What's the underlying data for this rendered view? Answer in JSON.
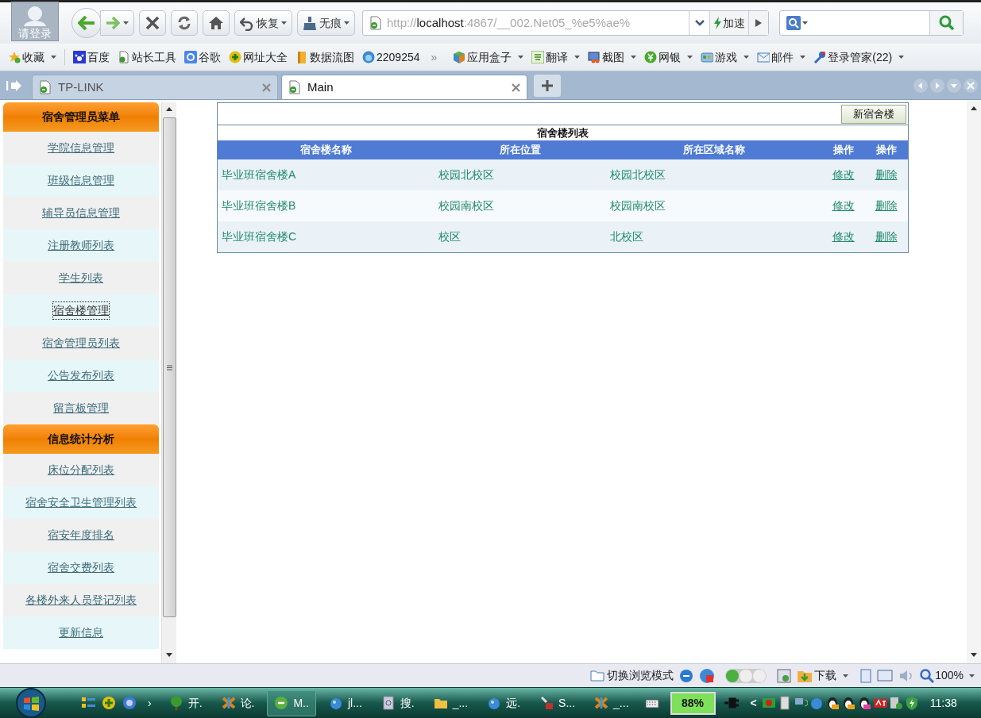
{
  "browser": {
    "login_label": "请登录",
    "nav_buttons": [
      {
        "label": "恢复"
      },
      {
        "label": "无痕"
      }
    ],
    "address": {
      "scheme": "http://",
      "host": "localhost",
      "path": ":4867/__002.Net05_%e5%ae%"
    },
    "speed_button": "加速"
  },
  "favorites": {
    "items": [
      {
        "label": "收藏",
        "kind": "menu"
      },
      {
        "label": "百度",
        "kind": "link"
      },
      {
        "label": "站长工具",
        "kind": "link"
      },
      {
        "label": "谷歌",
        "kind": "link"
      },
      {
        "label": "网址大全",
        "kind": "link"
      },
      {
        "label": "数据流图",
        "kind": "link"
      },
      {
        "label": "2209254",
        "kind": "link"
      },
      {
        "label": "»",
        "kind": "more"
      },
      {
        "label": "应用盒子",
        "kind": "menu"
      },
      {
        "label": "翻译",
        "kind": "menu"
      },
      {
        "label": "截图",
        "kind": "menu"
      },
      {
        "label": "网银",
        "kind": "menu"
      },
      {
        "label": "游戏",
        "kind": "menu"
      },
      {
        "label": "邮件",
        "kind": "menu"
      },
      {
        "label": "登录管家(22)",
        "kind": "menu"
      }
    ]
  },
  "tabs": [
    {
      "label": "TP-LINK",
      "selected": false
    },
    {
      "label": "Main",
      "selected": true
    }
  ],
  "sidebar": {
    "sections": [
      {
        "title": "宿舍管理员菜单",
        "items": [
          {
            "label": "学院信息管理",
            "selected": false
          },
          {
            "label": "班级信息管理",
            "selected": false
          },
          {
            "label": "辅导员信息管理",
            "selected": false
          },
          {
            "label": "注册教师列表",
            "selected": false
          },
          {
            "label": "学生列表",
            "selected": false
          },
          {
            "label": "宿舍楼管理",
            "selected": true
          },
          {
            "label": "宿舍管理员列表",
            "selected": false
          },
          {
            "label": "公告发布列表",
            "selected": false
          },
          {
            "label": "留言板管理",
            "selected": false
          }
        ]
      },
      {
        "title": "信息统计分析",
        "items": [
          {
            "label": "床位分配列表",
            "selected": false
          },
          {
            "label": "宿舍安全卫生管理列表",
            "selected": false
          },
          {
            "label": "宿安年度排名",
            "selected": false
          },
          {
            "label": "宿舍交费列表",
            "selected": false
          },
          {
            "label": "各楼外来人员登记列表",
            "selected": false
          },
          {
            "label": "更新信息",
            "selected": false
          }
        ]
      }
    ]
  },
  "main": {
    "add_button": "新宿舍楼",
    "table": {
      "title": "宿舍楼列表",
      "columns": [
        "宿舍楼名称",
        "所在位置",
        "所在区域名称",
        "操作",
        "操作"
      ],
      "rows": [
        {
          "cells": [
            "毕业班宿舍楼A",
            "校园北校区",
            "校园北校区"
          ],
          "actions": [
            "修改",
            "删除"
          ]
        },
        {
          "cells": [
            "毕业班宿舍楼B",
            "校园南校区",
            "校园南校区"
          ],
          "actions": [
            "修改",
            "删除"
          ]
        },
        {
          "cells": [
            "毕业班宿舍楼C",
            "校区",
            "北校区"
          ],
          "actions": [
            "修改",
            "删除"
          ]
        }
      ]
    }
  },
  "status_bar": {
    "mode_switch": "切换浏览模式",
    "downloads": "下载",
    "zoom": "100%"
  },
  "taskbar": {
    "apps": [
      {
        "label": "开.",
        "selected": false
      },
      {
        "label": "论.",
        "selected": false
      },
      {
        "label": "M..",
        "selected": true
      },
      {
        "label": "jl...",
        "selected": false
      },
      {
        "label": "搜.",
        "selected": false
      },
      {
        "label": "_...",
        "selected": false
      },
      {
        "label": "远.",
        "selected": false
      },
      {
        "label": "S...",
        "selected": false
      },
      {
        "label": "_...",
        "selected": false
      }
    ],
    "chevron": "›",
    "battery": "88%",
    "tray_toggle": "<",
    "clock": "11:38"
  }
}
